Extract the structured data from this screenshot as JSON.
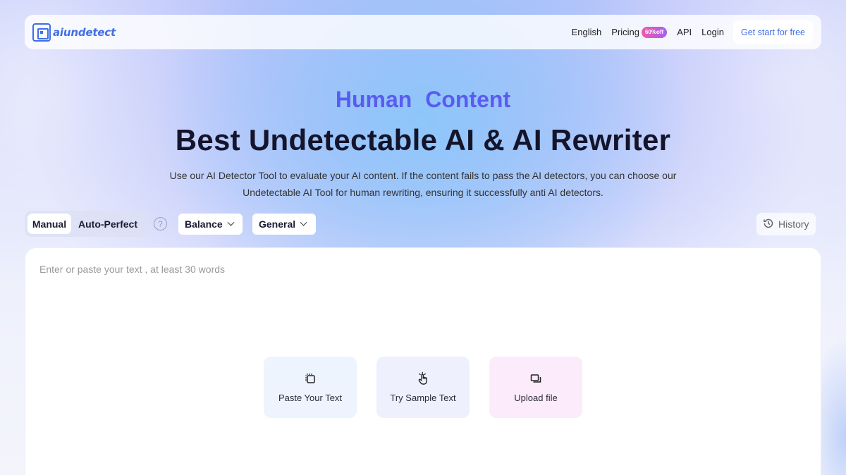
{
  "brand": {
    "name": "aiundetect",
    "accent": "#3f6fe6"
  },
  "nav": {
    "language": "English",
    "pricing": "Pricing",
    "pricing_badge": "60%off",
    "api": "API",
    "login": "Login",
    "cta": "Get start for free"
  },
  "hero": {
    "subtitle": "Human  Content",
    "title": "Best Undetectable AI & AI Rewriter",
    "description": "Use our AI Detector Tool to evaluate your AI content. If the content fails to pass the AI detectors, you can choose our Undetectable AI Tool for human rewriting, ensuring it successfully anti AI detectors."
  },
  "toolbar": {
    "modes": [
      "Manual",
      "Auto-Perfect"
    ],
    "selected_mode": "Manual",
    "help_symbol": "?",
    "strength": "Balance",
    "purpose": "General",
    "history": "History"
  },
  "editor": {
    "placeholder": "Enter or paste your text , at least 30 words",
    "actions": {
      "paste": "Paste Your Text",
      "sample": "Try Sample Text",
      "upload": "Upload file"
    }
  },
  "icons": [
    "logo-icon",
    "question-icon",
    "chevron-down-icon",
    "history-icon",
    "paste-icon",
    "pointer-hand-icon",
    "upload-file-icon"
  ]
}
